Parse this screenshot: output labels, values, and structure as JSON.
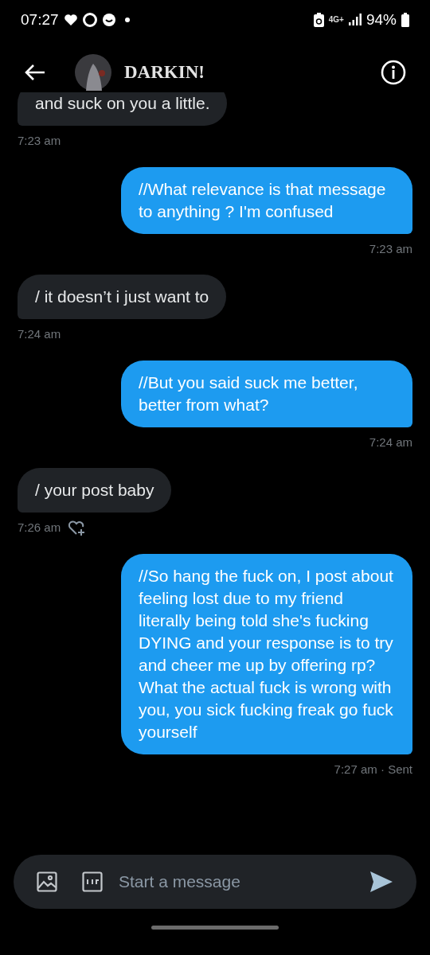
{
  "status_bar": {
    "time": "07:27",
    "network": "4G+",
    "battery": "94%"
  },
  "header": {
    "name": "DARKIN!"
  },
  "messages": [
    {
      "kind": "incoming",
      "text": "and suck on you a little.",
      "time": "7:23 am",
      "clipped": true,
      "react_button": false
    },
    {
      "kind": "outgoing",
      "text": "//What relevance is that message to anything ? I'm confused",
      "time": "7:23 am",
      "clipped": false,
      "react_button": false
    },
    {
      "kind": "incoming",
      "text": "/ it doesn’t i just want to",
      "time": "7:24 am",
      "clipped": false,
      "react_button": false
    },
    {
      "kind": "outgoing",
      "text": "//But you said suck me better, better from what?",
      "time": "7:24 am",
      "clipped": false,
      "react_button": false
    },
    {
      "kind": "incoming",
      "text": "/ your post baby",
      "time": "7:26 am",
      "clipped": false,
      "react_button": true
    },
    {
      "kind": "outgoing",
      "text": "//So hang the fuck on, I post about feeling lost due to my friend literally being told she's fucking DYING and your response is to try and cheer me up by offering rp? What the actual fuck is wrong with you, you sick fucking freak go fuck yourself",
      "time": "7:27 am · Sent",
      "clipped": false,
      "react_button": false
    }
  ],
  "composer": {
    "placeholder": "Start a message"
  }
}
